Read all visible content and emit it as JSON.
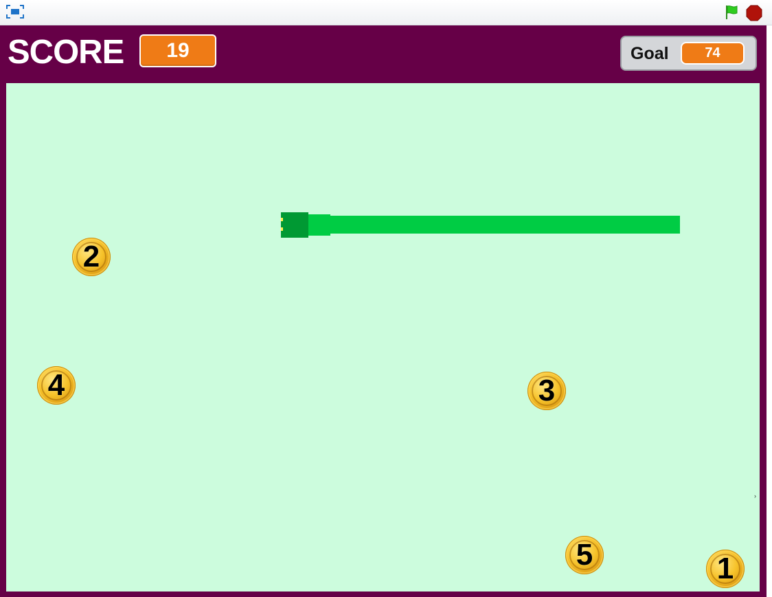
{
  "toolbar": {
    "fullscreen_icon": "fullscreen-toggle-icon",
    "flag_icon": "green-flag-icon",
    "stop_icon": "stop-sign-icon",
    "flag_color": "#2ecc1f",
    "stop_color": "#b0120a"
  },
  "hud": {
    "score_label": "SCORE",
    "score_value": "19",
    "goal_label": "Goal",
    "goal_value": "74"
  },
  "colors": {
    "stage_border": "#660047",
    "playfield": "#ccfcdd",
    "snake_body": "#00cc44",
    "snake_head": "#009933",
    "monitor_orange": "#ef7b16"
  },
  "coins": [
    {
      "number": "2"
    },
    {
      "number": "4"
    },
    {
      "number": "3"
    },
    {
      "number": "5"
    },
    {
      "number": "1"
    }
  ],
  "stage_marker": "›"
}
